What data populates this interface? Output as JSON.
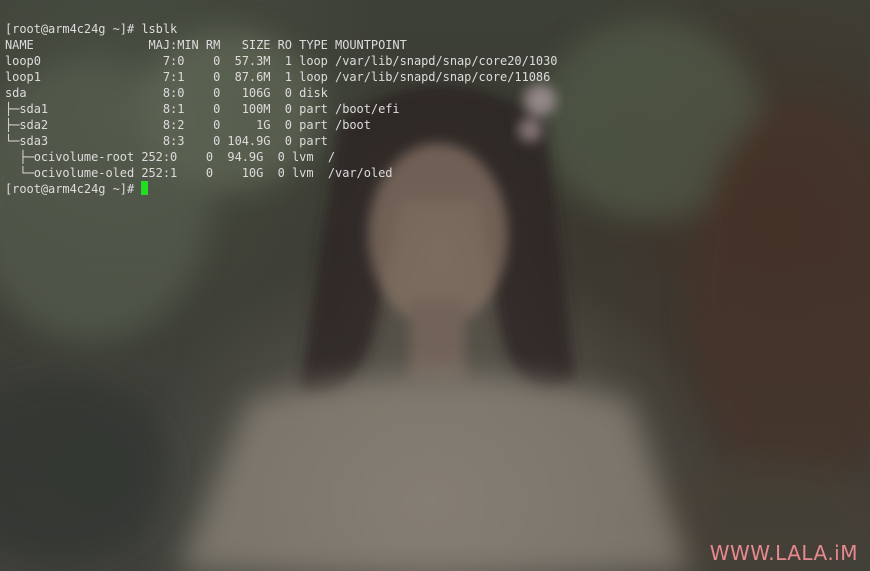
{
  "terminal": {
    "lines": [
      "[root@arm4c24g ~]# lsblk",
      "NAME                MAJ:MIN RM   SIZE RO TYPE MOUNTPOINT",
      "loop0                 7:0    0  57.3M  1 loop /var/lib/snapd/snap/core20/1030",
      "loop1                 7:1    0  87.6M  1 loop /var/lib/snapd/snap/core/11086",
      "sda                   8:0    0   106G  0 disk",
      "├─sda1                8:1    0   100M  0 part /boot/efi",
      "├─sda2                8:2    0     1G  0 part /boot",
      "└─sda3                8:3    0 104.9G  0 part",
      "  ├─ocivolume-root 252:0    0  94.9G  0 lvm  /",
      "  └─ocivolume-oled 252:1    0    10G  0 lvm  /var/oled"
    ],
    "prompt": "[root@arm4c24g ~]# ",
    "cursor_color": "#22dd22"
  },
  "watermark": {
    "text": "WWW.LALA.iM",
    "color": "#e6898f"
  }
}
